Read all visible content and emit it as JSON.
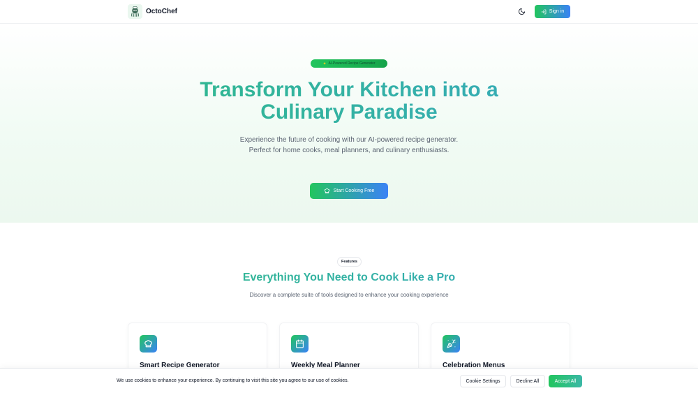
{
  "header": {
    "brand_name": "OctoChef",
    "logo_icon": "octopus-chef-logo",
    "theme_toggle_icon": "moon-icon",
    "signin_label": "Sign in",
    "signin_icon": "login-icon"
  },
  "hero": {
    "badge_text": "AI-Powered Recipe Generator",
    "title_line1": "Transform Your Kitchen into a",
    "title_line2": "Culinary Paradise",
    "subtitle": "Experience the future of cooking with our AI-powered recipe generator. Perfect for home cooks, meal planners, and culinary enthusiasts.",
    "cta_label": "Start Cooking Free",
    "cta_icon": "chef-hat-icon"
  },
  "features": {
    "badge": "Features",
    "title": "Everything You Need to Cook Like a Pro",
    "subtitle": "Discover a complete suite of tools designed to enhance your cooking experience",
    "cards": [
      {
        "title": "Smart Recipe Generator",
        "icon": "chef-hat-icon"
      },
      {
        "title": "Weekly Meal Planner",
        "icon": "calendar-icon"
      },
      {
        "title": "Celebration Menus",
        "icon": "party-popper-icon"
      }
    ]
  },
  "cookie": {
    "message": "We use cookies to enhance your experience. By continuing to visit this site you agree to our use of cookies.",
    "settings_label": "Cookie Settings",
    "decline_label": "Decline All",
    "accept_label": "Accept All"
  },
  "colors": {
    "accent_green": "#22c55e",
    "accent_blue": "#3b82f6",
    "title_gradient_start": "#2dbd7e",
    "title_gradient_end": "#3aa6c9"
  }
}
